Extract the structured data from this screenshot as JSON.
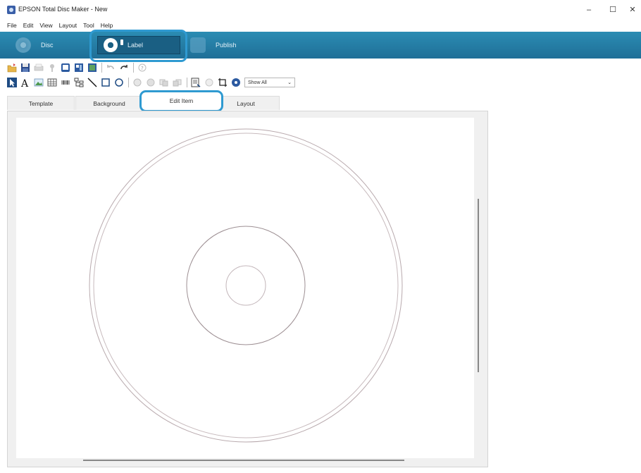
{
  "window": {
    "title": "EPSON Total Disc Maker - New",
    "controls": {
      "minimize": "–",
      "maximize": "☐",
      "close": "✕"
    }
  },
  "menu": [
    "File",
    "Edit",
    "View",
    "Layout",
    "Tool",
    "Help"
  ],
  "modes": [
    {
      "label": "Disc",
      "icon": "disc-icon"
    },
    {
      "label": "Label",
      "icon": "label-disc-icon",
      "active": true
    },
    {
      "label": "Publish",
      "icon": "publish-icon"
    }
  ],
  "toolbar2": {
    "show_select": "Show All"
  },
  "tabs": [
    {
      "label": "Template"
    },
    {
      "label": "Background"
    },
    {
      "label": "Edit Item",
      "active": true
    },
    {
      "label": "Layout"
    }
  ],
  "colors": {
    "mode_band": "#1f6f97",
    "highlight": "#2f9ad1",
    "disc_line": "#b8a9ad"
  }
}
